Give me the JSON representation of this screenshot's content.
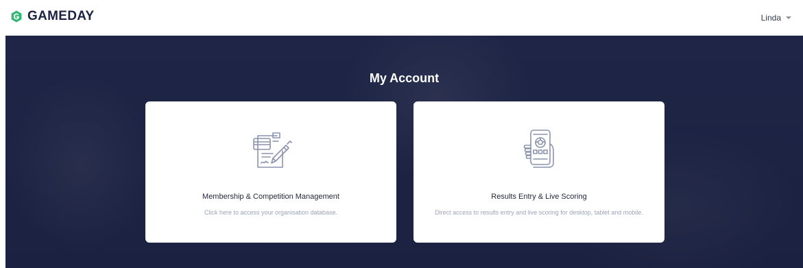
{
  "header": {
    "logo_text": "GAMEDAY",
    "user_name": "Linda"
  },
  "main": {
    "title": "My Account",
    "cards": [
      {
        "title": "Membership & Competition Management",
        "description": "Click here to access your organisation database.",
        "icon": "membership-form-icon"
      },
      {
        "title": "Results Entry & Live Scoring",
        "description": "Direct access to results entry and live scoring for desktop, tablet and mobile.",
        "icon": "mobile-scoring-icon"
      }
    ]
  },
  "colors": {
    "brand_green": "#2fb873",
    "navy": "#1c2342",
    "icon_stroke": "#8a93ad",
    "muted_text": "#9aa3b8"
  }
}
